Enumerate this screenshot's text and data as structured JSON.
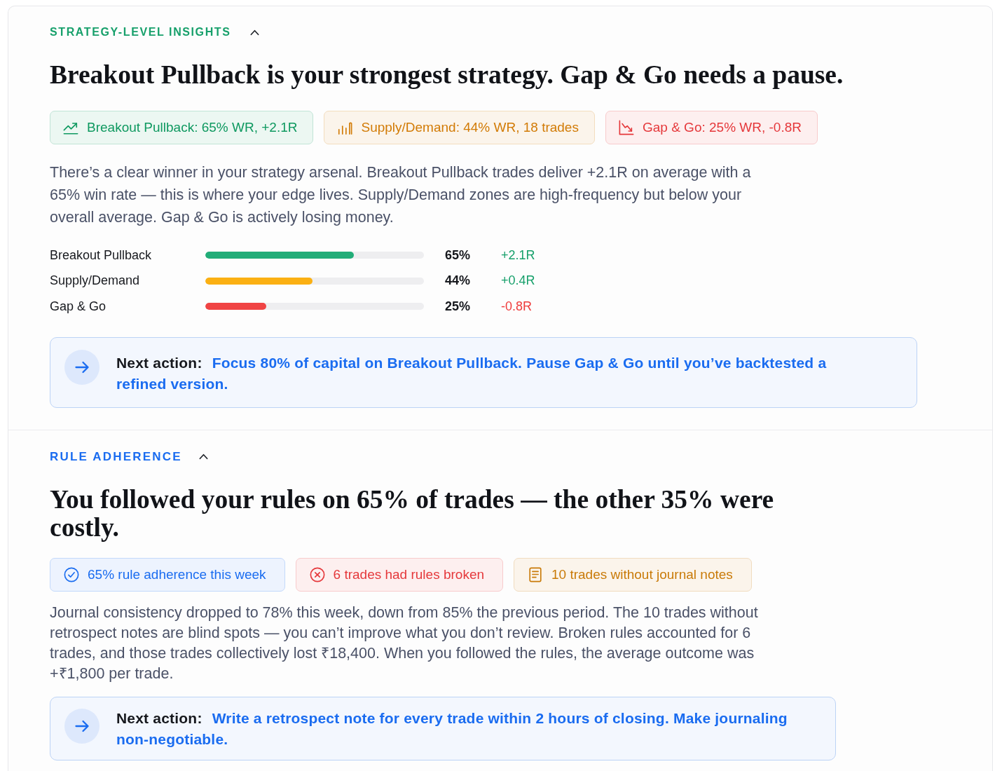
{
  "sections": [
    {
      "title": "STRATEGY-LEVEL INSIGHTS",
      "color": "#17a06b",
      "expanded": true,
      "headline": "Breakout Pullback is your strongest strategy. Gap & Go needs a pause.",
      "badges": [
        {
          "kind": "gain",
          "color": "#0f9960",
          "text": "Breakout Pullback: 65% WR, +2.1R"
        },
        {
          "kind": "volume",
          "color": "#d27b06",
          "text": "Supply/Demand: 44% WR, 18 trades"
        },
        {
          "kind": "loss",
          "color": "#e5383b",
          "text": "Gap & Go: 25% WR, -0.8R"
        }
      ],
      "summary": "There’s a clear winner in your strategy arsenal. Breakout Pullback trades deliver +2.1R on average with a 65% win rate — this is where your edge lives. Supply/Demand zones are high-frequency but below your overall average. Gap & Go is actively losing money.",
      "strategies": [
        {
          "name": "Breakout Pullback",
          "level": 0.68,
          "color": "#22ad78",
          "win_rate": "65%",
          "result": "+2.1R",
          "positive": true
        },
        {
          "name": "Supply/Demand",
          "level": 0.49,
          "color": "#fbb013",
          "win_rate": "44%",
          "result": "+0.4R",
          "positive": true
        },
        {
          "name": "Gap & Go",
          "level": 0.28,
          "color": "#f04444",
          "win_rate": "25%",
          "result": "-0.8R",
          "positive": false
        }
      ],
      "action": {
        "label": "Next action:",
        "text": "Focus 80% of capital on Breakout Pullback. Pause Gap & Go until you’ve backtested a refined version."
      }
    },
    {
      "title": "RULE ADHERENCE",
      "color": "#1a6cf0",
      "expanded": true,
      "headline": "You followed your rules on 65% of trades — the other 35% were costly.",
      "badges": [
        {
          "kind": "success",
          "color": "#1a6cf0",
          "text": "65% rule adherence this week"
        },
        {
          "kind": "error",
          "color": "#e5383b",
          "text": "6 trades had rules broken"
        },
        {
          "kind": "notes",
          "color": "#c97a08",
          "text": "10 trades without journal notes"
        }
      ],
      "summary": "Journal consistency dropped to 78% this week, down from 85% the previous period. The 10 trades without retrospect notes are blind spots — you can’t improve what you don’t review. Broken rules accounted for 6 trades, and those trades collectively lost ₹18,400. When you followed the rules, the average outcome was +₹1,800 per trade.",
      "action": {
        "label": "Next action:",
        "text": "Write a retrospect note for every trade within 2 hours of closing. Make journaling non-negotiable."
      }
    }
  ]
}
